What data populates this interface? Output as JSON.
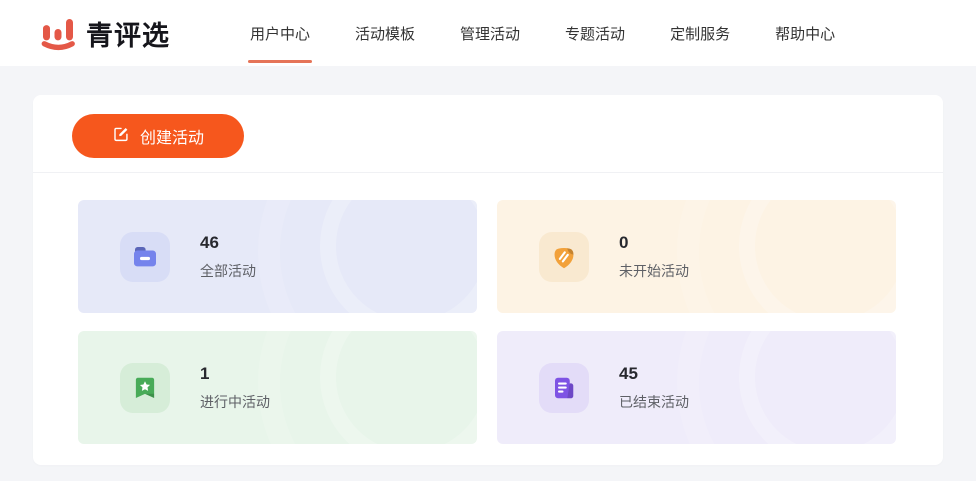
{
  "header": {
    "logo_text": "青评选",
    "nav": [
      {
        "label": "用户中心",
        "active": true
      },
      {
        "label": "活动模板",
        "active": false
      },
      {
        "label": "管理活动",
        "active": false
      },
      {
        "label": "专题活动",
        "active": false
      },
      {
        "label": "定制服务",
        "active": false
      },
      {
        "label": "帮助中心",
        "active": false
      }
    ]
  },
  "main": {
    "create_button": {
      "label": "创建活动",
      "icon": "edit-icon"
    },
    "stats": [
      {
        "value": "46",
        "label": "全部活动",
        "icon": "folder-icon",
        "bg": "#e6e9f8",
        "icon_bg": "#d8ddf6",
        "icon_color": "#7583ec"
      },
      {
        "value": "0",
        "label": "未开始活动",
        "icon": "badge-icon",
        "bg": "#fdf3e4",
        "icon_bg": "#f9e9d0",
        "icon_color": "#f2a13a"
      },
      {
        "value": "1",
        "label": "进行中活动",
        "icon": "bookmark-star-icon",
        "bg": "#e8f5ea",
        "icon_bg": "#d6edd8",
        "icon_color": "#48ab58"
      },
      {
        "value": "45",
        "label": "已结束活动",
        "icon": "document-icon",
        "bg": "#efecfa",
        "icon_bg": "#e3dcf8",
        "icon_color": "#7e53e4"
      }
    ]
  },
  "colors": {
    "accent": "#f6571d",
    "logo": "#e45847",
    "underline": "#e57458",
    "page_bg": "#f4f5f8"
  }
}
